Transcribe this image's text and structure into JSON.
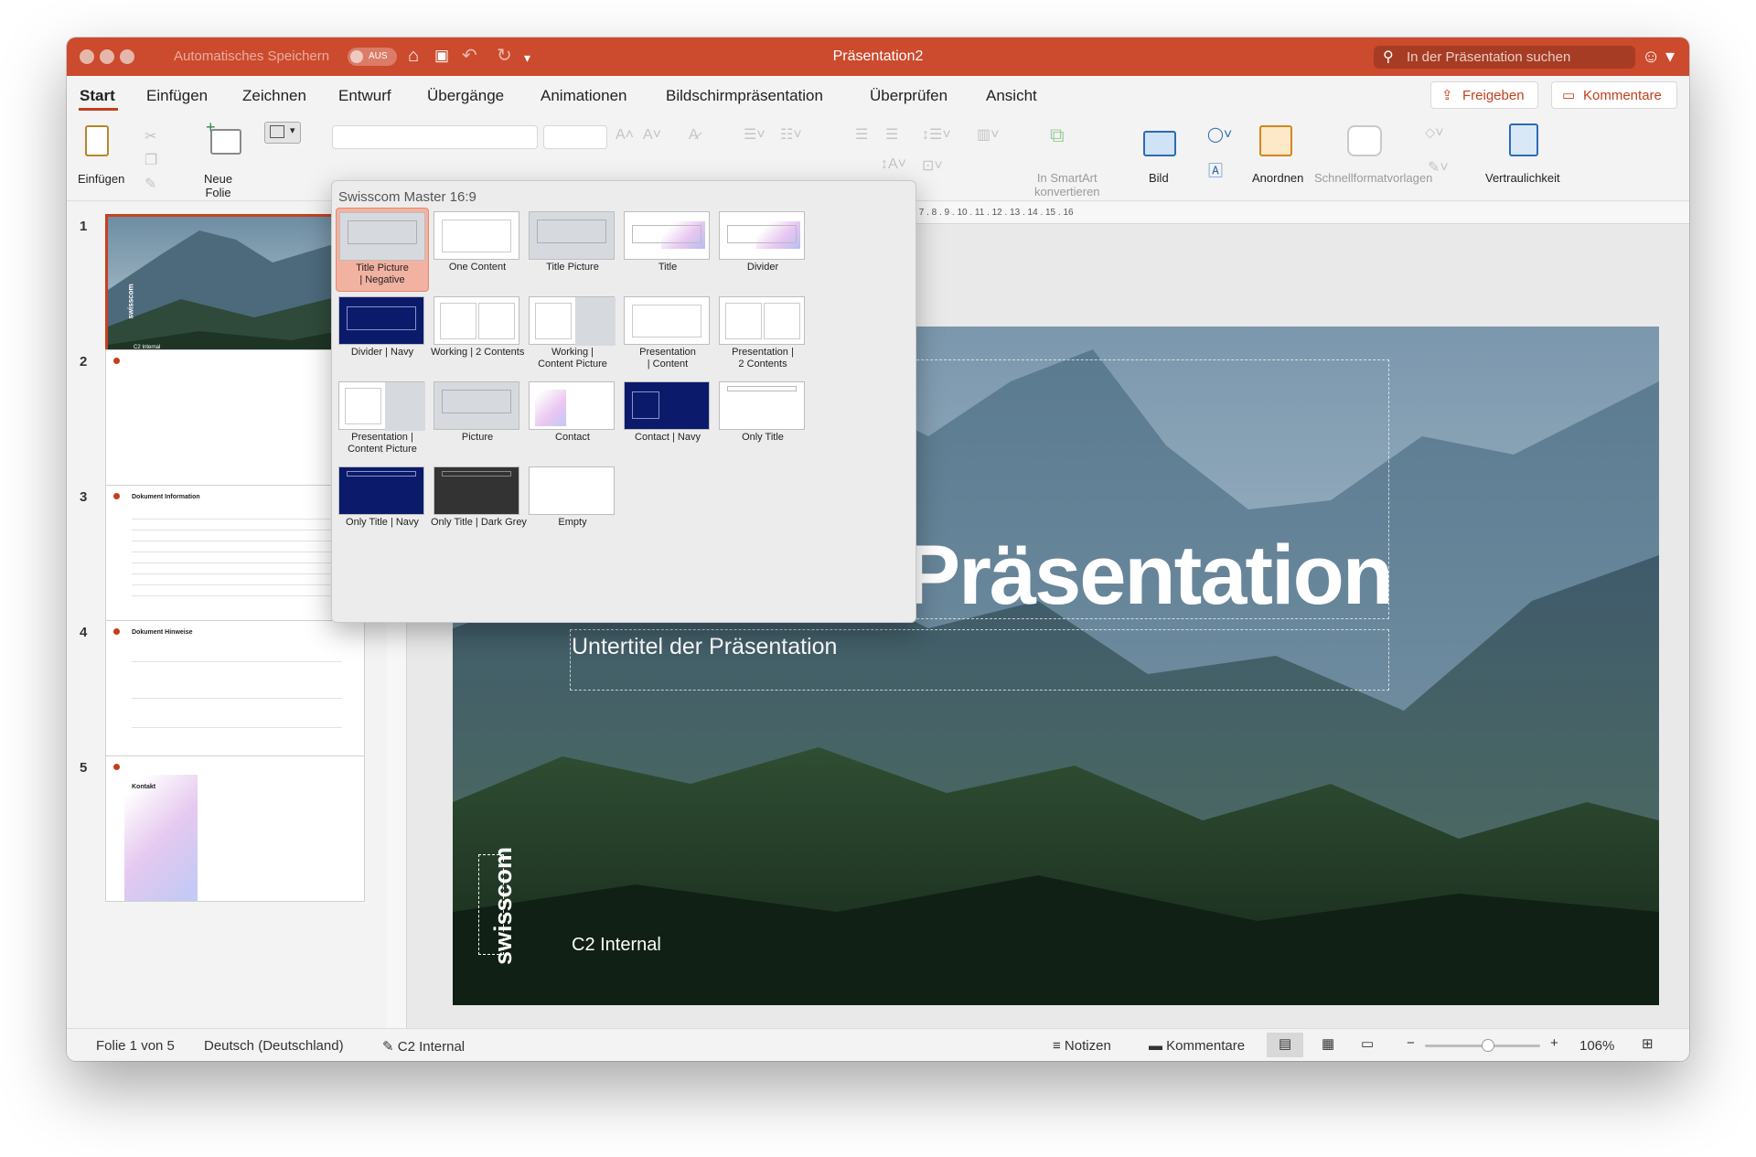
{
  "window": {
    "title": "Präsentation2",
    "autosave_label": "Automatisches Speichern",
    "autosave_state": "AUS",
    "search_placeholder": "In der Präsentation suchen"
  },
  "menu": {
    "tabs": [
      "Start",
      "Einfügen",
      "Zeichnen",
      "Entwurf",
      "Übergänge",
      "Animationen",
      "Bildschirmpräsentation",
      "Überprüfen",
      "Ansicht"
    ],
    "active": "Start",
    "share_label": "Freigeben",
    "comments_label": "Kommentare"
  },
  "ribbon": {
    "paste_label": "Einfügen",
    "new_slide_label": "Neue\nFolie",
    "smartart_label": "In SmartArt\nkonvertieren",
    "picture_label": "Bild",
    "arrange_label": "Anordnen",
    "quick_styles_label": "Schnellformatvorlagen",
    "confidentiality_label": "Vertraulichkeit"
  },
  "layout_gallery": {
    "header": "Swisscom Master 16:9",
    "selected": "Title Picture | Negative",
    "layouts": [
      {
        "name": "Title Picture\n| Negative",
        "style": "picture"
      },
      {
        "name": "One Content",
        "style": "content"
      },
      {
        "name": "Title Picture",
        "style": "picture2"
      },
      {
        "name": "Title",
        "style": "title"
      },
      {
        "name": "Divider",
        "style": "divider"
      },
      {
        "name": "Divider | Navy",
        "style": "navy"
      },
      {
        "name": "Working | 2 Contents",
        "style": "two"
      },
      {
        "name": "Working |\nContent Picture",
        "style": "contpic"
      },
      {
        "name": "Presentation\n| Content",
        "style": "pres"
      },
      {
        "name": "Presentation |\n2 Contents",
        "style": "pres2"
      },
      {
        "name": "Presentation |\nContent Picture",
        "style": "prespic"
      },
      {
        "name": "Picture",
        "style": "pic"
      },
      {
        "name": "Contact",
        "style": "contact"
      },
      {
        "name": "Contact | Navy",
        "style": "contactnavy"
      },
      {
        "name": "Only Title",
        "style": "onlytitle"
      },
      {
        "name": "Only Title | Navy",
        "style": "onlytitlenavy"
      },
      {
        "name": "Only Title | Dark Grey",
        "style": "darkgrey"
      },
      {
        "name": "Empty",
        "style": "empty"
      }
    ]
  },
  "slides_panel": {
    "numbers": [
      "1",
      "2",
      "3",
      "4",
      "5"
    ],
    "slide3_heading": "Dokument Information",
    "slide4_heading": "Dokument Hinweise",
    "slide5_heading": "Kontakt",
    "slide1_footer": "C2 Internal",
    "slide1_brand": "swisscom"
  },
  "slide": {
    "title": "Titel der Präsentation",
    "subtitle": "Untertitel der Präsentation",
    "classification": "C2 Internal",
    "brand": "swisscom"
  },
  "status": {
    "slide_counter": "Folie 1 von 5",
    "language": "Deutsch (Deutschland)",
    "sensitivity": "C2 Internal",
    "notes": "Notizen",
    "comments": "Kommentare",
    "zoom": "106%",
    "zoom_level": 0.55
  },
  "colors": {
    "accent": "#c43e1c",
    "titlebar": "#cc4a2d",
    "navy": "#0b1a6b",
    "dark_grey": "#333333"
  }
}
